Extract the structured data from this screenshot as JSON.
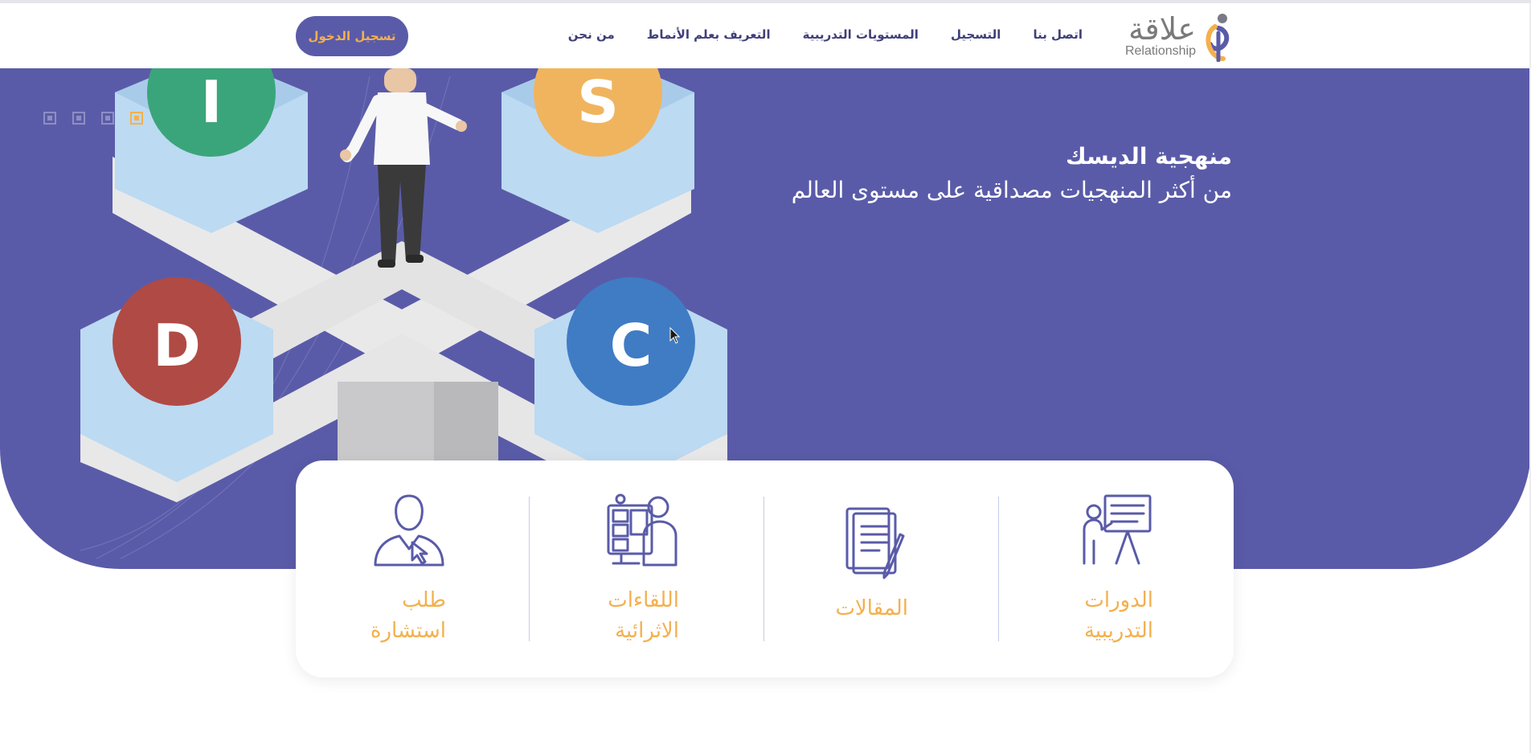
{
  "logo": {
    "arabic": "علاقة",
    "english": "Relationship",
    "icon": "relationship-logo-mark"
  },
  "nav": {
    "items": [
      {
        "label": "من نحن"
      },
      {
        "label": "التعريف بعلم الأنماط"
      },
      {
        "label": "المستويات التدريبية"
      },
      {
        "label": "التسجيل"
      },
      {
        "label": "اتصل بنا"
      }
    ],
    "login_label": "تسجيل الدخول"
  },
  "hero": {
    "title": "منهجية الديسك",
    "subtitle": "من أكثر المنهجيات مصداقية على مستوى العالم",
    "disc_letters": [
      "D",
      "I",
      "S",
      "C"
    ],
    "slides": {
      "count": 4,
      "active_index": 3
    }
  },
  "services": [
    {
      "label_line1": "الدورات",
      "label_line2": "التدريبية",
      "icon": "training-presentation-icon"
    },
    {
      "label_line1": "المقالات",
      "label_line2": "",
      "icon": "articles-notebook-icon"
    },
    {
      "label_line1": "اللقاءات",
      "label_line2": "الاثرائية",
      "icon": "video-meetings-icon"
    },
    {
      "label_line1": "طلب",
      "label_line2": "استشارة",
      "icon": "consultation-user-icon"
    }
  ],
  "colors": {
    "brand_purple": "#5a5ba8",
    "accent_orange": "#f4b04e",
    "nav_text": "#3f3f7a",
    "disc_d": "#b04a44",
    "disc_i": "#3aa57a",
    "disc_s": "#f0b45e",
    "disc_c": "#3f7cc4"
  }
}
